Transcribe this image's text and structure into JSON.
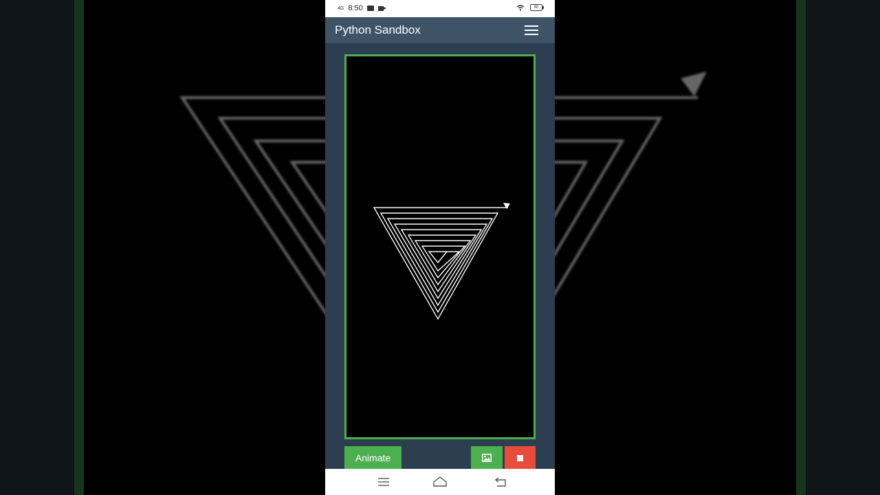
{
  "status_bar": {
    "network": "4G",
    "time": "8:50",
    "battery_level": "80"
  },
  "header": {
    "title": "Python Sandbox"
  },
  "canvas": {
    "border_color": "#4caf50",
    "background_color": "#000000",
    "stroke_color": "#ffffff",
    "drawing": "triangle-spiral"
  },
  "controls": {
    "animate_label": "Animate",
    "image_button_icon": "image-icon",
    "stop_button_icon": "stop-icon",
    "primary_color": "#4caf50",
    "danger_color": "#e74c3c"
  },
  "nav_bar": {
    "items": [
      "menu-icon",
      "home-icon",
      "back-icon"
    ]
  }
}
